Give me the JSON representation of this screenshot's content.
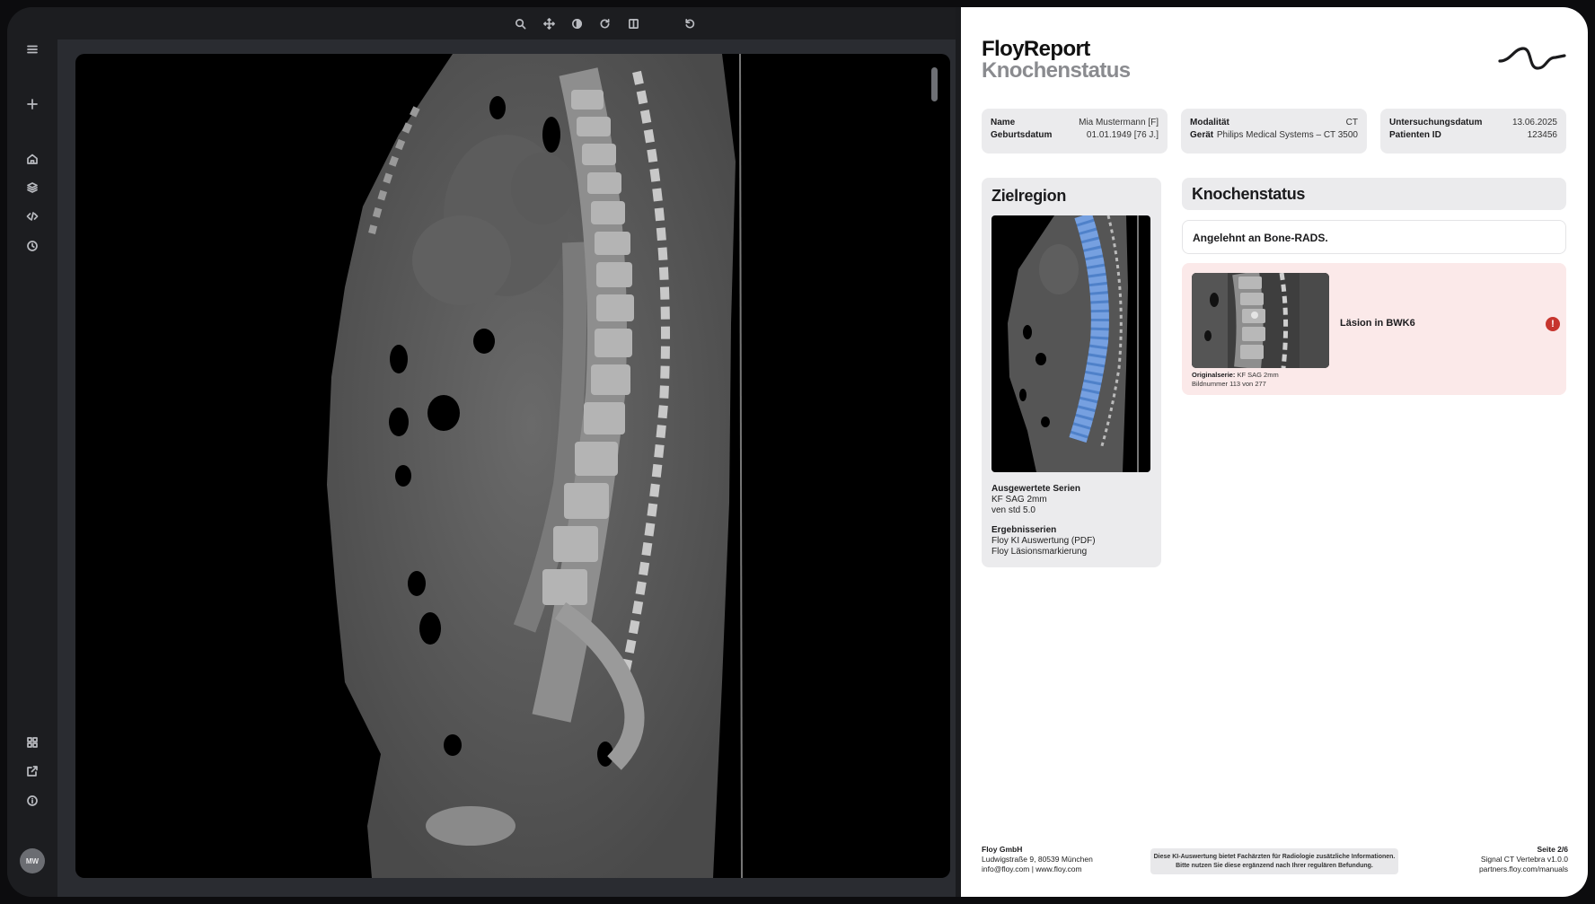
{
  "viewer": {
    "sidebar": {
      "top_icons": [
        "menu-icon",
        "plus-icon",
        "home-icon",
        "layers-icon",
        "code-icon",
        "clock-icon"
      ],
      "bottom_icons": [
        "grid-icon",
        "external-link-icon",
        "info-icon"
      ],
      "avatar_initials": "MW"
    },
    "toolbar": {
      "icons": [
        "search-icon",
        "move-icon",
        "contrast-icon",
        "rotate-icon",
        "split-view-icon",
        "undo-icon"
      ]
    }
  },
  "report": {
    "brand": {
      "title": "FloyReport",
      "subtitle": "Knochenstatus"
    },
    "patient": {
      "name_label": "Name",
      "name_value": "Mia Mustermann [F]",
      "dob_label": "Geburtsdatum",
      "dob_value": "01.01.1949 [76 J.]"
    },
    "device": {
      "modality_label": "Modalität",
      "modality_value": "CT",
      "device_label": "Gerät",
      "device_value": "Philips Medical Systems – CT 3500"
    },
    "exam": {
      "date_label": "Untersuchungsdatum",
      "date_value": "13.06.2025",
      "pid_label": "Patienten ID",
      "pid_value": "123456"
    },
    "zielregion": {
      "title": "Zielregion",
      "evaluated_heading": "Ausgewertete Serien",
      "evaluated": [
        "KF SAG 2mm",
        "ven std 5.0"
      ],
      "results_heading": "Ergebnisserien",
      "results": [
        "Floy KI Auswertung (PDF)",
        "Floy Läsionsmarkierung"
      ]
    },
    "knochenstatus": {
      "title": "Knochenstatus",
      "note": "Angelehnt an Bone-RADS.",
      "lesion_label": "Läsion in BWK6",
      "caption_series_label": "Originalserie:",
      "caption_series_value": "KF SAG 2mm",
      "caption_image": "Bildnummer 113 von 277",
      "alert_symbol": "!"
    },
    "footer": {
      "company": "Floy GmbH",
      "address": "Ludwigstraße 9, 80539 München",
      "contact": "info@floy.com | www.floy.com",
      "disclaimer_1": "Diese KI-Auswertung bietet Fachärzten für Radiologie zusätzliche Informationen.",
      "disclaimer_2": "Bitte nutzen Sie diese ergänzend nach Ihrer regulären Befundung.",
      "page": "Seite 2/6",
      "product": "Signal CT Vertebra v1.0.0",
      "manuals": "partners.floy.com/manuals"
    },
    "colors": {
      "alert": "#c6352e",
      "lesion_bg": "#fbe9e9",
      "spine_overlay": "#4f86d6"
    }
  }
}
